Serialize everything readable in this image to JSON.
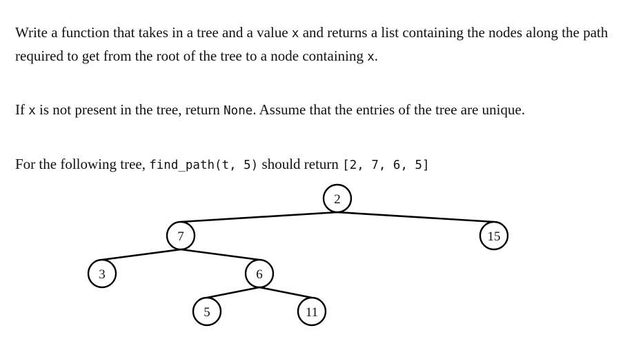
{
  "cut_line": "……, ……, …… …… ……………… ……",
  "paragraph1": {
    "a": "Write a function that takes in a tree and a value ",
    "b": "x",
    "c": " and returns a list containing the nodes along the path required to get from the root of the tree to a node containing ",
    "d": "x",
    "e": "."
  },
  "paragraph2": {
    "a": "If ",
    "b": "x",
    "c": " is not present in the tree, return ",
    "d": "None",
    "e": ". Assume that the entries of the tree are unique."
  },
  "paragraph3": {
    "a": "For the following tree, ",
    "b": "find_path(t, 5)",
    "c": " should return ",
    "d": "[2, 7, 6, 5]"
  },
  "tree": {
    "nodes": {
      "n2": "2",
      "n7": "7",
      "n15": "15",
      "n3": "3",
      "n6": "6",
      "n5": "5",
      "n11": "11"
    }
  }
}
